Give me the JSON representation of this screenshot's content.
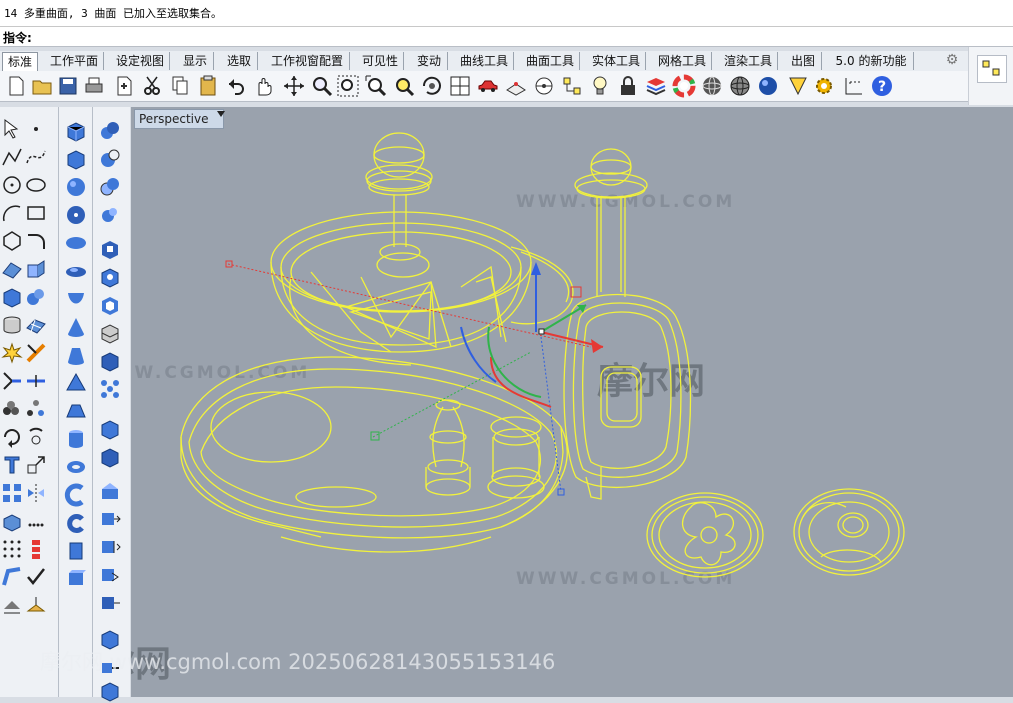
{
  "history": {
    "text": "14 多重曲面, 3 曲面 已加入至选取集合。"
  },
  "command": {
    "label": "指令:",
    "value": ""
  },
  "tabs": [
    {
      "label": "标准",
      "active": true
    },
    {
      "label": "工作平面"
    },
    {
      "label": "设定视图"
    },
    {
      "label": "显示"
    },
    {
      "label": "选取"
    },
    {
      "label": "工作视窗配置"
    },
    {
      "label": "可见性"
    },
    {
      "label": "变动"
    },
    {
      "label": "曲线工具"
    },
    {
      "label": "曲面工具"
    },
    {
      "label": "实体工具"
    },
    {
      "label": "网格工具"
    },
    {
      "label": "渲染工具"
    },
    {
      "label": "出图"
    },
    {
      "label": "5.0 的新功能"
    }
  ],
  "toolbar_icons": [
    "new-icon",
    "open-icon",
    "save-icon",
    "print-icon",
    "import-icon",
    "cut-icon",
    "copy-icon",
    "paste-icon",
    "undo-icon",
    "pan-hand-icon",
    "rotate-view-icon",
    "zoom-icon",
    "zoom-window-icon",
    "zoom-extents-icon",
    "zoom-selected-icon",
    "rotate-camera-icon",
    "four-view-icon",
    "car-model-icon",
    "grid-snap-icon",
    "osnap-icon",
    "select-points-icon",
    "light-icon",
    "lock-icon",
    "layer-icon",
    "color-wheel-icon",
    "wireframe-sphere-icon",
    "ghost-sphere-icon",
    "render-sphere-icon",
    "material-icon",
    "options-gear-icon",
    "dimension-icon",
    "help-icon"
  ],
  "viewport": {
    "label": "Perspective",
    "display_mode": "wireframe"
  },
  "watermark": {
    "site": "WWW.CGMOL.COM",
    "brand": "摩尔网",
    "footer": "摩尔网 www.cgmol.com 20250628143055153146"
  },
  "colors": {
    "selection": "#f2f23c",
    "viewport_bg": "#9aa2ad",
    "axis_x": "#e53935",
    "axis_y": "#2fb44a",
    "axis_z": "#2f5fe0"
  }
}
